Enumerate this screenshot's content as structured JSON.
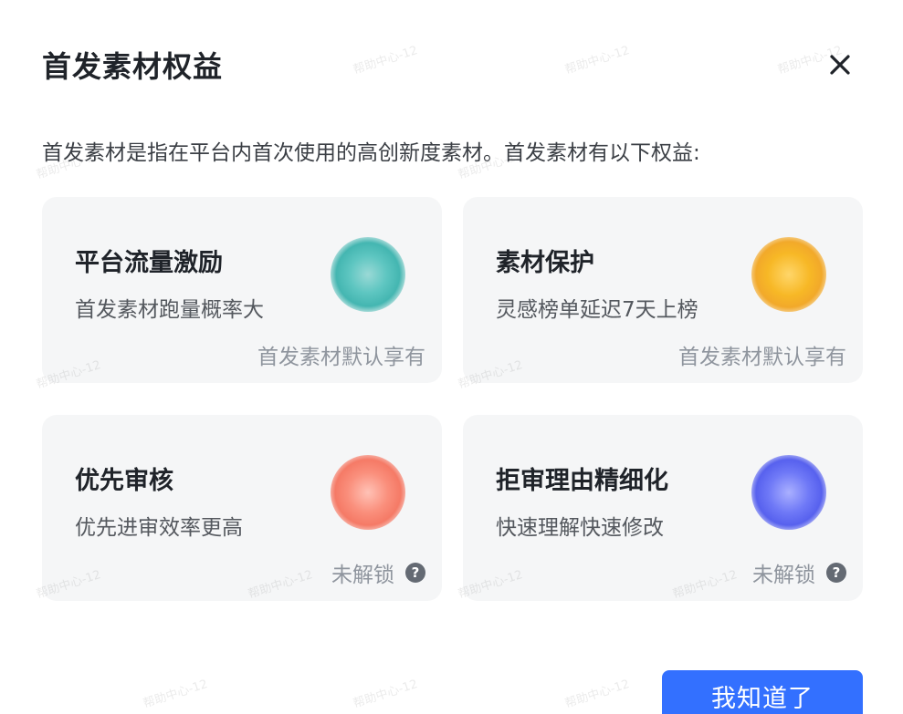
{
  "dialog": {
    "title": "首发素材权益",
    "description": "首发素材是指在平台内首次使用的高创新度素材。首发素材有以下权益:",
    "confirm_label": "我知道了"
  },
  "cards": [
    {
      "title": "平台流量激励",
      "subtitle": "首发素材跑量概率大",
      "status": "首发素材默认享有",
      "badge_color": "#44b6b1"
    },
    {
      "title": "素材保护",
      "subtitle": "灵感榜单延迟7天上榜",
      "status": "首发素材默认享有",
      "badge_color": "#f2a92a"
    },
    {
      "title": "优先审核",
      "subtitle": "优先进审效率更高",
      "status": "未解锁",
      "badge_color": "#f57a66"
    },
    {
      "title": "拒审理由精细化",
      "subtitle": "快速理解快速修改",
      "status": "未解锁",
      "badge_color": "#5761ee"
    }
  ],
  "icons": {
    "close": "close-icon",
    "help": "?"
  },
  "watermark_text": "帮助中心-12",
  "colors": {
    "primary": "#3370ff",
    "card_bg": "#f5f6f7"
  }
}
